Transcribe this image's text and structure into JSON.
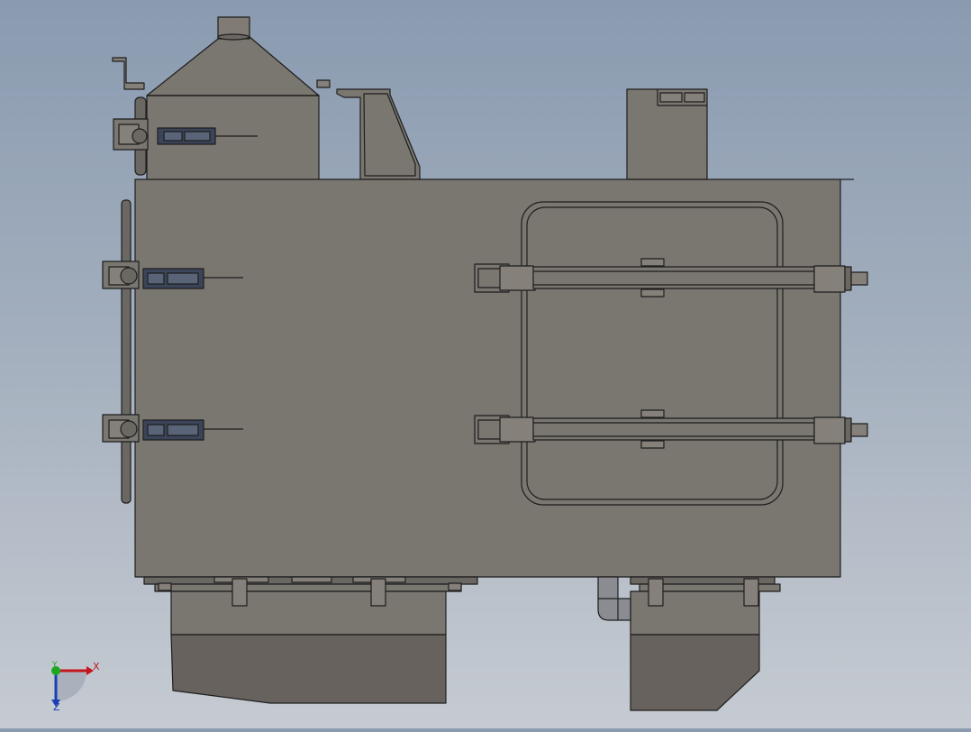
{
  "window": {
    "title": ""
  },
  "colors": {
    "body": "#7a7670",
    "body_dark": "#6b6763",
    "body_light": "#858079",
    "outline": "#1e1e1e",
    "latch_fill": "#3b4458",
    "latch_light": "#5a6478",
    "pipe": "#8a8c92",
    "axis_x": "#c2161a",
    "axis_y": "#1ca81c",
    "axis_z": "#1a3fb4"
  },
  "triad": {
    "x_label": "X",
    "y_label": "Y",
    "z_label": "Z"
  }
}
